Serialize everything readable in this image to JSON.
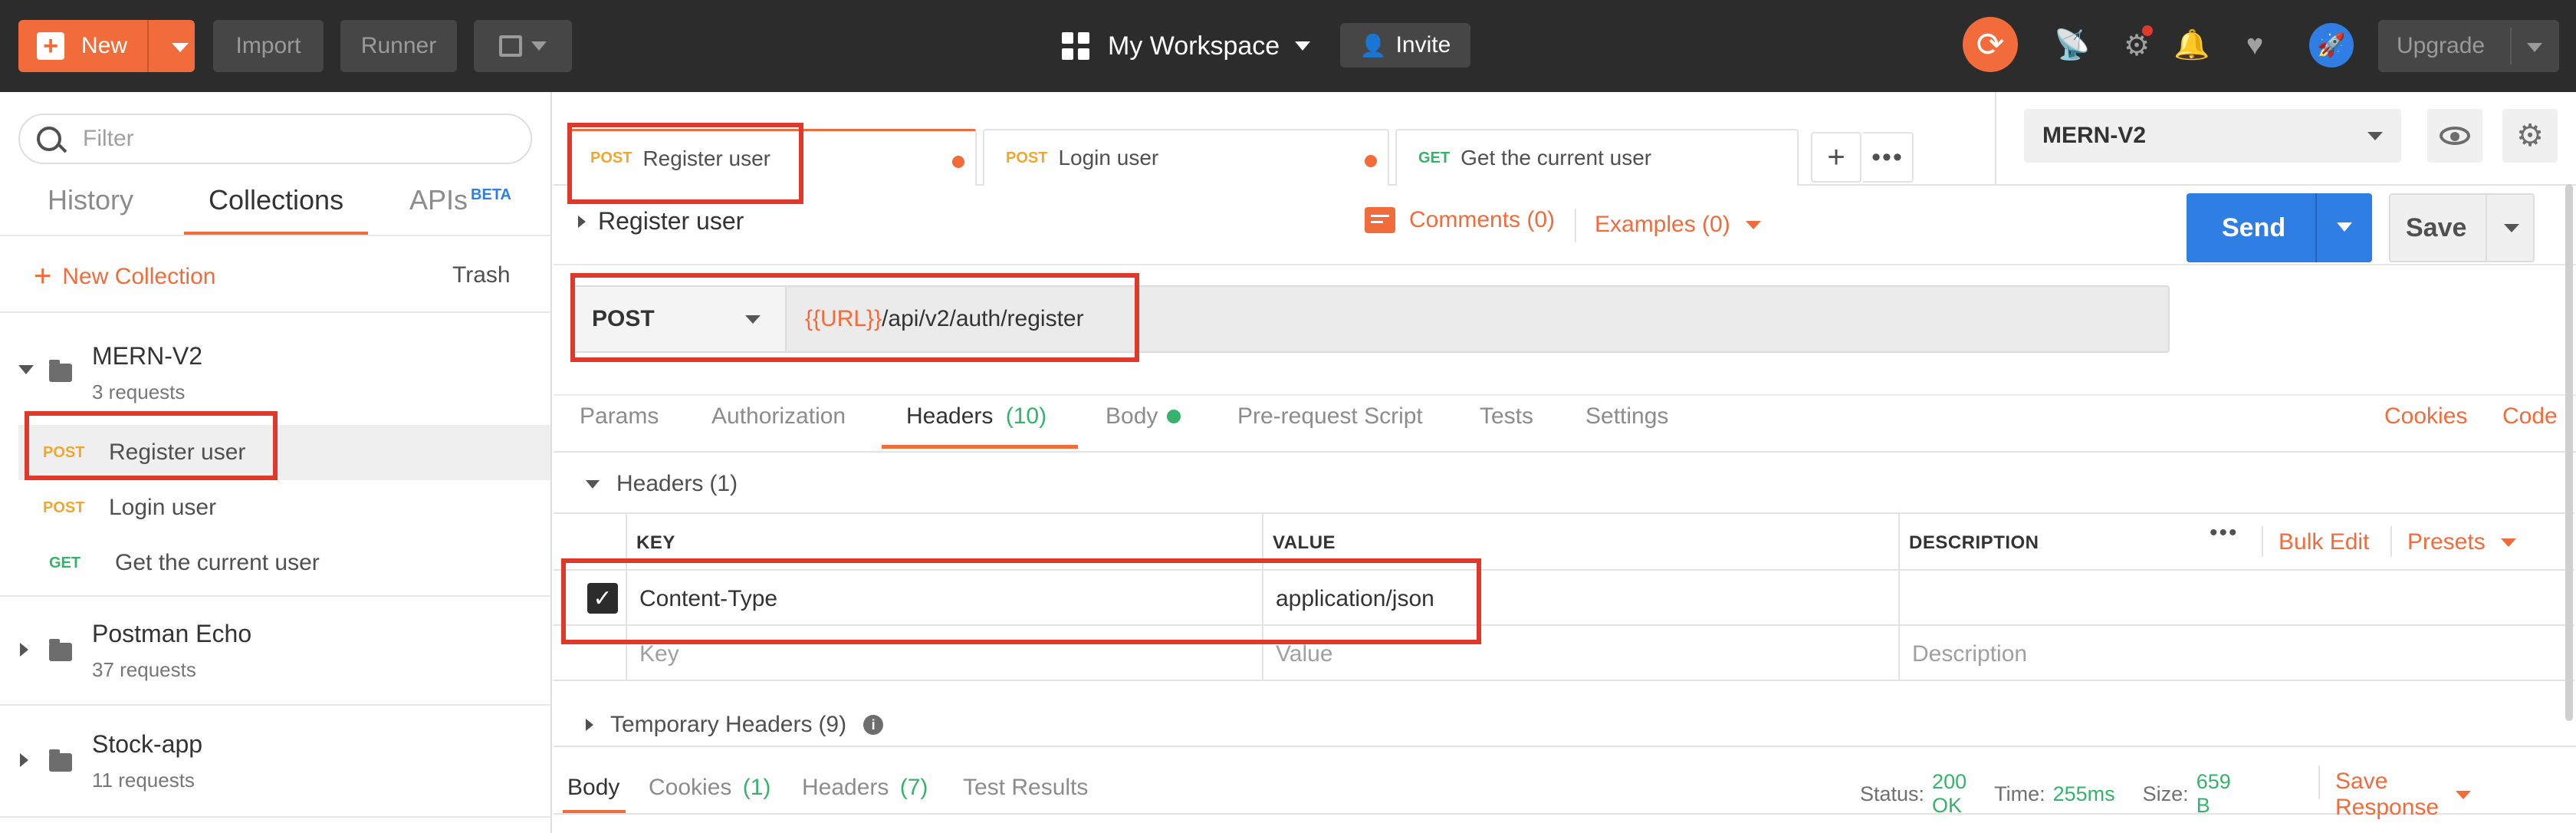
{
  "topbar": {
    "new_label": "New",
    "import_label": "Import",
    "runner_label": "Runner",
    "workspace_label": "My Workspace",
    "invite_label": "Invite",
    "upgrade_label": "Upgrade"
  },
  "sidebar": {
    "filter_placeholder": "Filter",
    "tabs": {
      "history": "History",
      "collections": "Collections",
      "apis": "APIs",
      "apis_badge": "BETA"
    },
    "new_collection": "New Collection",
    "trash": "Trash",
    "collections": [
      {
        "name": "MERN-V2",
        "count": "3 requests",
        "requests": [
          {
            "method": "POST",
            "name": "Register user"
          },
          {
            "method": "POST",
            "name": "Login user"
          },
          {
            "method": "GET",
            "name": "Get the current user"
          }
        ]
      },
      {
        "name": "Postman Echo",
        "count": "37 requests"
      },
      {
        "name": "Stock-app",
        "count": "11 requests"
      }
    ]
  },
  "tabs": [
    {
      "method": "POST",
      "name": "Register user"
    },
    {
      "method": "POST",
      "name": "Login user"
    },
    {
      "method": "GET",
      "name": "Get the current user"
    }
  ],
  "request": {
    "title": "Register user",
    "comments": "Comments (0)",
    "examples": "Examples (0)",
    "method": "POST",
    "url_var": "{{URL}}",
    "url_path": "/api/v2/auth/register",
    "send": "Send",
    "save": "Save"
  },
  "subtabs": {
    "params": "Params",
    "authorization": "Authorization",
    "headers": "Headers",
    "headers_count": "(10)",
    "body": "Body",
    "prerequest": "Pre-request Script",
    "tests": "Tests",
    "settings": "Settings",
    "cookies": "Cookies",
    "code": "Code"
  },
  "headers_section": {
    "title": "Headers",
    "count": "(1)",
    "col_key": "KEY",
    "col_value": "VALUE",
    "col_description": "DESCRIPTION",
    "bulk_edit": "Bulk Edit",
    "presets": "Presets",
    "rows": [
      {
        "key": "Content-Type",
        "value": "application/json",
        "checked": true
      }
    ],
    "placeholder_key": "Key",
    "placeholder_value": "Value",
    "placeholder_description": "Description",
    "temporary": "Temporary Headers",
    "temporary_count": "(9)"
  },
  "response": {
    "body": "Body",
    "cookies": "Cookies",
    "cookies_count": "(1)",
    "headers": "Headers",
    "headers_count": "(7)",
    "test_results": "Test Results",
    "status_label": "Status:",
    "status_value": "200 OK",
    "time_label": "Time:",
    "time_value": "255ms",
    "size_label": "Size:",
    "size_value": "659 B",
    "save_response": "Save Response"
  },
  "environment": {
    "selected": "MERN-V2"
  },
  "colors": {
    "accent": "#f26b3a",
    "send": "#2f7ee3",
    "post": "#f0a730",
    "get": "#36b36a",
    "highlight": "#e0392b"
  }
}
